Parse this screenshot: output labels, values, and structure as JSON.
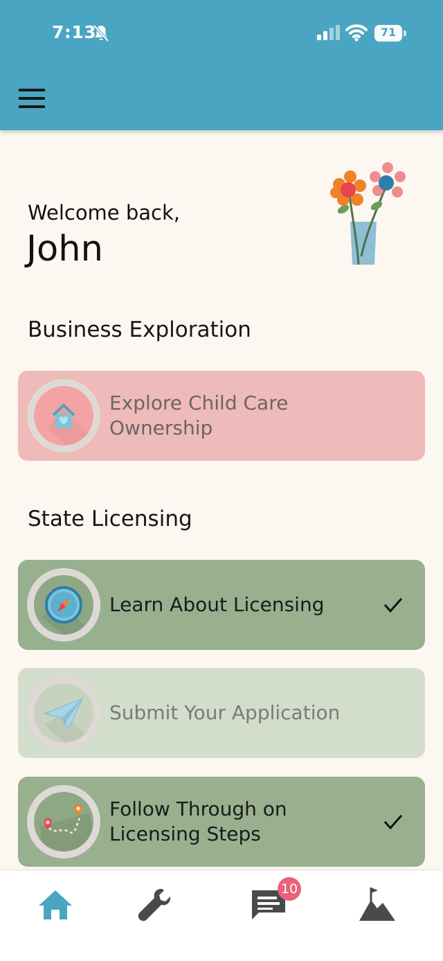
{
  "status_bar": {
    "time": "7:13",
    "bell_icon": "bell-slash-icon",
    "signal_icon": "cellular-signal-icon",
    "wifi_icon": "wifi-icon",
    "battery_level": "71"
  },
  "header": {
    "menu_icon": "hamburger-menu-icon",
    "background_color": "#4aa5c2"
  },
  "greeting": {
    "line": "Welcome back,",
    "name": "John",
    "illustration": "flower-vase-icon"
  },
  "sections": [
    {
      "title": "Business Exploration",
      "cards": [
        {
          "label_line1": "Explore Child Care",
          "label_line2": "Ownership",
          "icon": "house-heart-icon",
          "completed": false,
          "color": "#efbaba"
        }
      ]
    },
    {
      "title": "State Licensing",
      "cards": [
        {
          "label": "Learn About Licensing",
          "icon": "compass-icon",
          "completed": true,
          "color": "#98b08e"
        },
        {
          "label": "Submit Your Application",
          "icon": "paper-plane-icon",
          "completed": false,
          "color": "#d3ddcb"
        },
        {
          "label_line1": "Follow Through on",
          "label_line2": "Licensing Steps",
          "icon": "map-route-icon",
          "completed": true,
          "color": "#98b08e"
        }
      ]
    }
  ],
  "bottom_nav": {
    "items": [
      {
        "name": "home",
        "icon": "home-icon",
        "active": true
      },
      {
        "name": "tools",
        "icon": "wrench-icon",
        "active": false
      },
      {
        "name": "messages",
        "icon": "chat-icon",
        "active": false,
        "badge": "10"
      },
      {
        "name": "goals",
        "icon": "mountain-flag-icon",
        "active": false
      }
    ],
    "accent_color": "#4aa5c2",
    "inactive_color": "#4a4a4a",
    "badge_color": "#e8627a"
  }
}
